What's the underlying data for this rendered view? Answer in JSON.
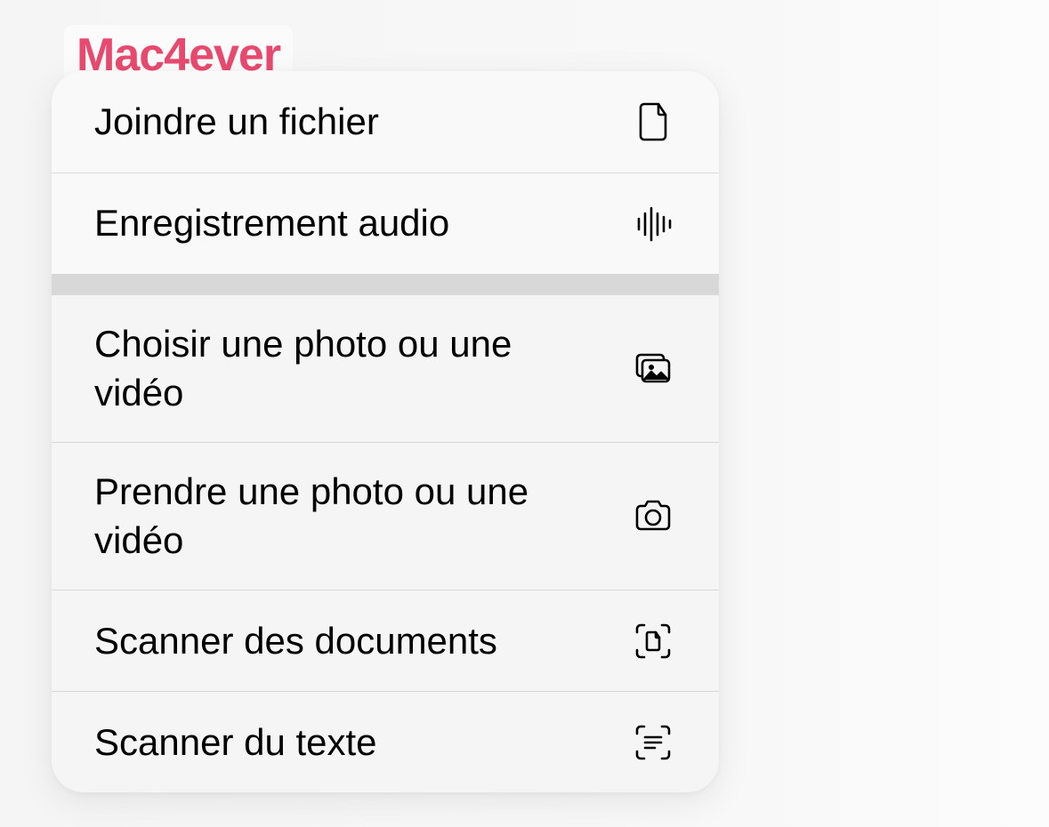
{
  "watermark": "Mac4ever",
  "menu": {
    "section1": [
      {
        "label": "Joindre un fichier",
        "icon": "document-icon"
      },
      {
        "label": "Enregistrement audio",
        "icon": "waveform-icon"
      }
    ],
    "section2": [
      {
        "label": "Choisir une photo ou une vidéo",
        "icon": "photo-library-icon"
      },
      {
        "label": "Prendre une photo ou une vidéo",
        "icon": "camera-icon"
      },
      {
        "label": "Scanner des documents",
        "icon": "scan-document-icon"
      },
      {
        "label": "Scanner du texte",
        "icon": "scan-text-icon"
      }
    ]
  }
}
